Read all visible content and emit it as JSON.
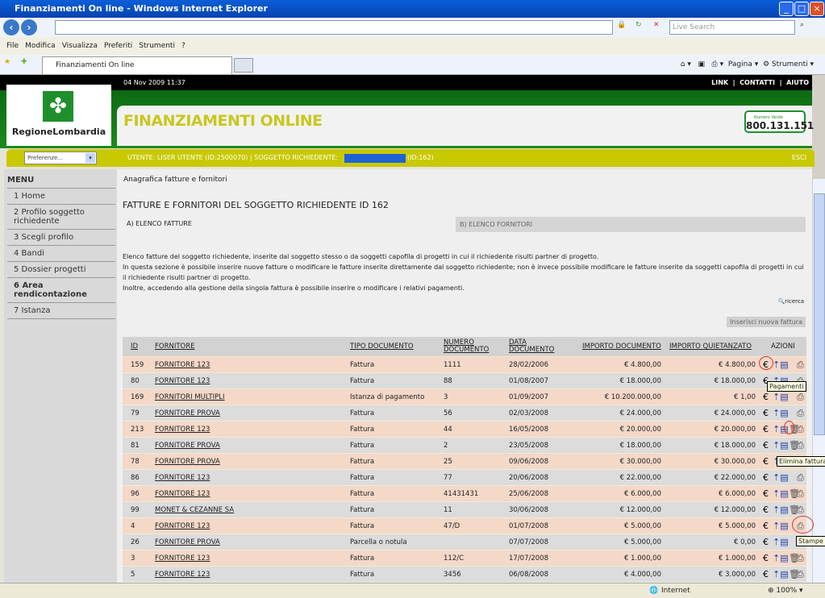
{
  "browser": {
    "title": "Finanziamenti On line - Windows Internet Explorer",
    "search_placeholder": "Live Search",
    "menu": [
      "File",
      "Modifica",
      "Visualizza",
      "Preferiti",
      "Strumenti",
      "?"
    ],
    "tab": "Finanziamenti On line",
    "tools": {
      "page": "Pagina",
      "tools": "Strumenti"
    },
    "status": {
      "zone": "Internet",
      "zoom": "100%"
    }
  },
  "header": {
    "datetime": "04 Nov 2009 11:37",
    "links": [
      "LINK",
      "CONTATTI",
      "AIUTO"
    ],
    "logo_text": "RegioneLombardia",
    "app_title": "FINANZIAMENTI ONLINE",
    "toll_free_label": "Numero Verde",
    "toll_free": "800.131.151"
  },
  "userbar": {
    "pref": "Preferenze...",
    "user": "UTENTE:  LISER UTENTE (ID:2500070)  |  SOGGETTO RICHIEDENTE:",
    "subject_id": "(ID:162)",
    "logout": "ESCI",
    "redacted_color": "#1e63d6"
  },
  "sidebar": {
    "title": "MENU",
    "items": [
      "1  Home",
      "2  Profilo soggetto richiedente",
      "3  Scegli profilo",
      "4  Bandi",
      "5  Dossier progetti",
      "6  Area rendicontazione",
      "7  Istanza"
    ],
    "active": 5
  },
  "main": {
    "breadcrumb": "Anagrafica fatture e fornitori",
    "title": "FATTURE E FORNITORI DEL SOGGETTO RICHIEDENTE ID 162",
    "tabs": [
      "A) ELENCO FATTURE",
      "B) ELENCO FORNITORI"
    ],
    "desc": [
      "Elenco fatture del soggetto richiedente, inserite dal soggetto stesso o da soggetti capofila di progetti in cui il richiedente risulti partner di progetto.",
      "In questa sezione è possibile inserire nuove fatture o modificare le fatture inserite direttamente dal soggetto richiedente; non è invece possibile modificare le fatture inserite da soggetti capofila di progetti in cui il richiedente risulti partner di progetto.",
      "Inoltre, accedendo alla gestione della singola fattura è possibile inserire o modificare i relativi pagamenti."
    ],
    "search": "ricerca",
    "new_invoice": "Inserisci nuova fattura",
    "columns": [
      "ID",
      "FORNITORE",
      "TIPO DOCUMENTO",
      "NUMERO DOCUMENTO",
      "DATA DOCUMENTO",
      "IMPORTO DOCUMENTO",
      "IMPORTO QUIETANZATO",
      "AZIONI"
    ],
    "row_colors": [
      "#f4d8c8",
      "#dcdcdc"
    ],
    "rows": [
      [
        "159",
        "FORNITORE 123",
        "Fattura",
        "1111",
        "28/02/2006",
        "€ 4.800,00",
        "€ 4.800,00",
        false
      ],
      [
        "80",
        "FORNITORE 123",
        "Fattura",
        "88",
        "01/08/2007",
        "€ 18.000,00",
        "€ 18.000,00",
        false
      ],
      [
        "169",
        "FORNITORI MULTIPLI",
        "Istanza di pagamento",
        "3",
        "01/09/2007",
        "€ 10.200.000,00",
        "€ 1,00",
        false
      ],
      [
        "79",
        "FORNITORE PROVA",
        "Fattura",
        "56",
        "02/03/2008",
        "€ 24.000,00",
        "€ 24.000,00",
        false
      ],
      [
        "213",
        "FORNITORE 123",
        "Fattura",
        "44",
        "16/05/2008",
        "€ 20.000,00",
        "€ 20.000,00",
        true
      ],
      [
        "81",
        "FORNITORE PROVA",
        "Fattura",
        "2",
        "23/05/2008",
        "€ 18.000,00",
        "€ 18.000,00",
        true
      ],
      [
        "78",
        "FORNITORE PROVA",
        "Fattura",
        "25",
        "09/06/2008",
        "€ 30.000,00",
        "€ 30.000,00",
        false
      ],
      [
        "86",
        "FORNITORE 123",
        "Fattura",
        "77",
        "20/06/2008",
        "€ 22.000,00",
        "€ 22.000,00",
        false
      ],
      [
        "96",
        "FORNITORE 123",
        "Fattura",
        "41431431",
        "25/06/2008",
        "€ 6.000,00",
        "€ 6.000,00",
        true
      ],
      [
        "99",
        "MONET & CEZANNE SA",
        "Fattura",
        "11",
        "30/06/2008",
        "€ 12.000,00",
        "€ 12.000,00",
        true
      ],
      [
        "4",
        "FORNITORE 123",
        "Fattura",
        "47/D",
        "01/07/2008",
        "€ 5.000,00",
        "€ 5.000,00",
        false
      ],
      [
        "26",
        "FORNITORE PROVA",
        "Parcella o notula",
        "",
        "07/07/2008",
        "€ 5.000,00",
        "€ 0,00",
        false
      ],
      [
        "3",
        "FORNITORE 123",
        "Fattura",
        "112/C",
        "17/07/2008",
        "€ 1.000,00",
        "€ 1.000,00",
        true
      ],
      [
        "5",
        "FORNITORE 123",
        "Fattura",
        "3456",
        "06/08/2008",
        "€ 4.000,00",
        "€ 3.000,00",
        true
      ]
    ],
    "tooltips": {
      "payments": "Pagamenti",
      "delete": "Elimina fattura",
      "print": "Stampe"
    }
  }
}
